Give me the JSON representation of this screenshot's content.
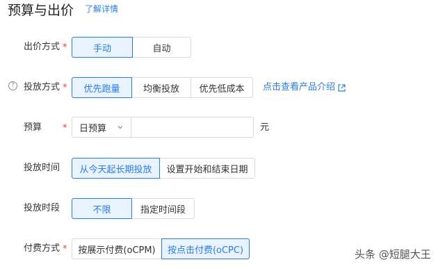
{
  "header": {
    "title": "预算与出价",
    "detail_link": "了解详情"
  },
  "bid_method": {
    "label": "出价方式",
    "options": [
      "手动",
      "自动"
    ],
    "selected": "手动"
  },
  "delivery_method": {
    "label": "投放方式",
    "options": [
      "优先跑量",
      "均衡投放",
      "优先低成本"
    ],
    "selected": "优先跑量",
    "product_link": "点击查看产品介绍"
  },
  "budget": {
    "label": "预算",
    "select_value": "日预算",
    "input_value": "",
    "unit": "元"
  },
  "delivery_time": {
    "label": "投放时间",
    "options": [
      "从今天起长期投放",
      "设置开始和结束日期"
    ],
    "selected": "从今天起长期投放"
  },
  "delivery_period": {
    "label": "投放时段",
    "options": [
      "不限",
      "指定时间段"
    ],
    "selected": "不限"
  },
  "payment_method": {
    "label": "付费方式",
    "options": [
      "按展示付费(oCPM)",
      "按点击付费(oCPC)"
    ],
    "selected": "按点击付费(oCPC)"
  },
  "required_mark": "*",
  "help_icon_glyph": "?",
  "watermark": "头条 @短腿大王",
  "colors": {
    "accent": "#2a7de1",
    "active_bg": "#e8f3ff",
    "required": "#f04134",
    "border": "#d9d9d9"
  },
  "icons": {
    "help": "question-circle-icon",
    "external": "external-link-icon",
    "dropdown": "chevron-down-icon"
  }
}
